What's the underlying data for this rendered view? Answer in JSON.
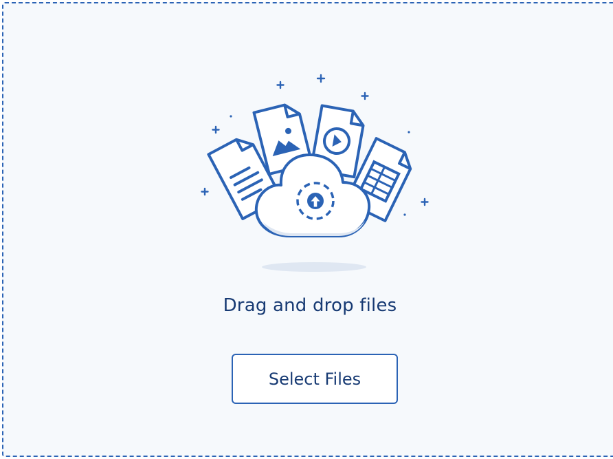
{
  "dropzone": {
    "prompt": "Drag and drop files",
    "select_button_label": "Select Files"
  },
  "illustration": {
    "icons": [
      "document-icon",
      "image-file-icon",
      "video-file-icon",
      "spreadsheet-file-icon",
      "cloud-upload-icon"
    ]
  },
  "colors": {
    "accent": "#2b63b5",
    "accent_dark": "#173a73",
    "background": "#f6f9fc",
    "shadow": "#dfe7f2"
  }
}
